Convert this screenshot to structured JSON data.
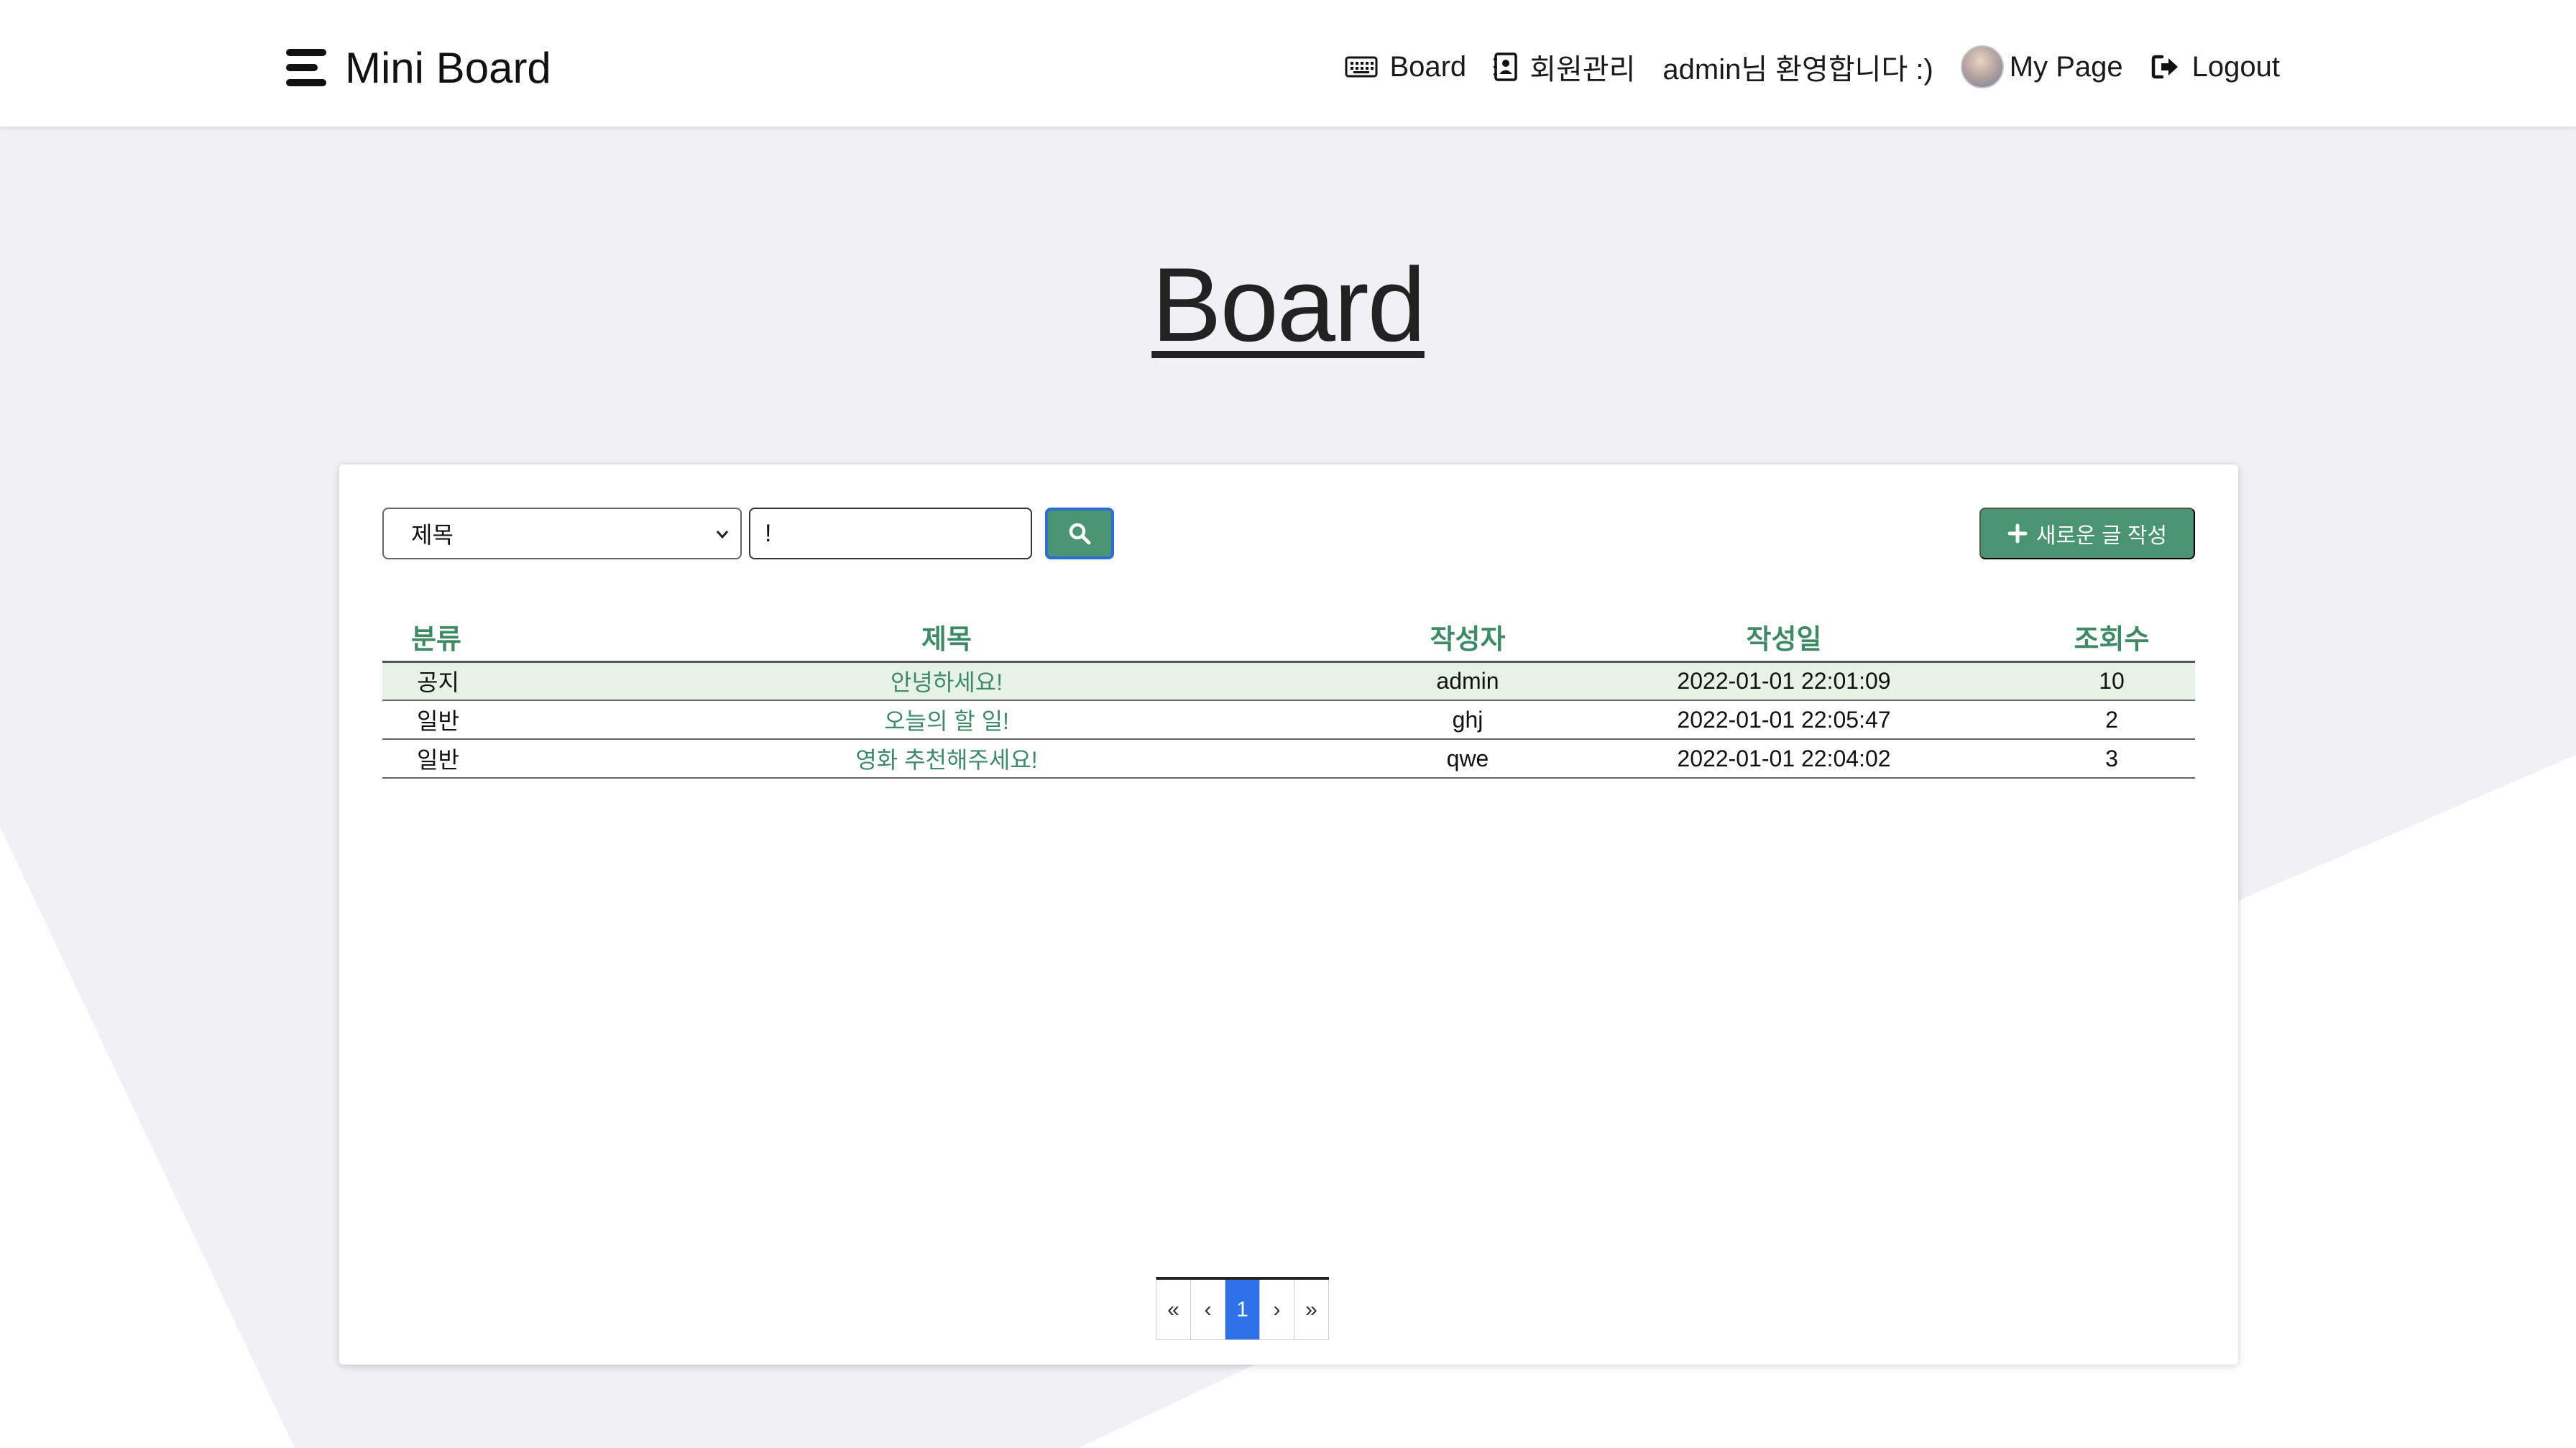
{
  "navbar": {
    "brand": "Mini Board",
    "items": [
      {
        "label": "Board",
        "icon": "keyboard-icon"
      },
      {
        "label": "회원관리",
        "icon": "contact-card-icon"
      },
      {
        "label": "admin님 환영합니다 :)"
      },
      {
        "label": "My Page",
        "icon": "avatar"
      },
      {
        "label": "Logout",
        "icon": "logout-icon"
      }
    ]
  },
  "page": {
    "title": "Board"
  },
  "search": {
    "field_selected": "제목",
    "query": "!",
    "new_post_label": "새로운 글 작성"
  },
  "table": {
    "headers": [
      "분류",
      "제목",
      "작성자",
      "작성일",
      "조회수"
    ],
    "rows": [
      {
        "category": "공지",
        "title": "안녕하세요!",
        "author": "admin",
        "date": "2022-01-01 22:01:09",
        "views": "10"
      },
      {
        "category": "일반",
        "title": "오늘의 할 일!",
        "author": "ghj",
        "date": "2022-01-01 22:05:47",
        "views": "2"
      },
      {
        "category": "일반",
        "title": "영화 추천해주세요!",
        "author": "qwe",
        "date": "2022-01-01 22:04:02",
        "views": "3"
      }
    ]
  },
  "pagination": {
    "first": "«",
    "prev": "‹",
    "current": "1",
    "next": "›",
    "last": "»"
  },
  "colors": {
    "accent_green": "#4a9571",
    "header_green": "#3f8a66",
    "notice_row_bg": "#e5f2e5",
    "active_page": "#2f72e8",
    "page_bg": "#f1f0f5"
  }
}
